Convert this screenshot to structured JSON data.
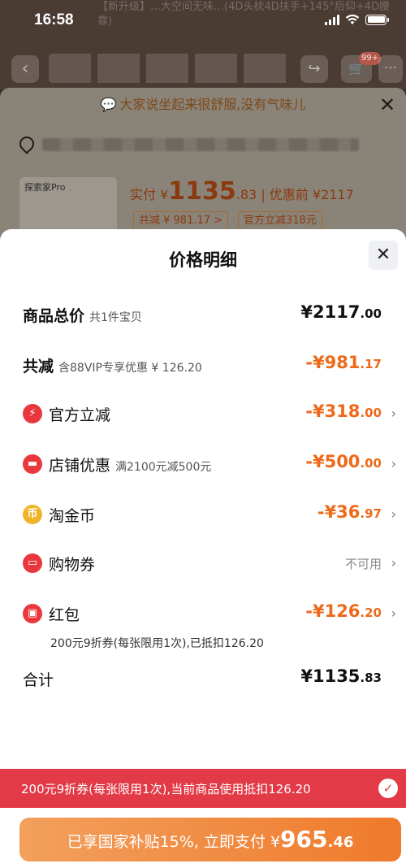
{
  "status": {
    "time": "16:58"
  },
  "background": {
    "title_text": "【新升级】…大空间无味…(4D头枕4D扶手+145°后仰+4D腰靠)",
    "cart_badge": "99+"
  },
  "secondary_sheet": {
    "tip": "大家说坐起来很舒服,没有气味儿",
    "product_thumb_label": "探索家Pro",
    "real_price_prefix": "实付 ¥",
    "real_price_int": "1135",
    "real_price_dec": ".83",
    "before_discount": "| 优惠前 ¥2117",
    "tag_reduce": "共减 ¥ 981.17 >",
    "tag_official": "官方立减318元"
  },
  "sheet": {
    "title": "价格明细",
    "rows": [
      {
        "label": "商品总价",
        "sub": "共1件宝贝",
        "amount_int": "¥2117",
        "amount_dec": ".00"
      },
      {
        "label": "共减",
        "sub": "含88VIP专享优惠 ¥ 126.20",
        "amount_int": "-¥981",
        "amount_dec": ".17"
      },
      {
        "label": "官方立减",
        "amount_int": "-¥318",
        "amount_dec": ".00"
      },
      {
        "label": "店铺优惠",
        "sub": "满2100元减500元",
        "amount_int": "-¥500",
        "amount_dec": ".00"
      },
      {
        "label": "淘金币",
        "amount_int": "-¥36",
        "amount_dec": ".97"
      },
      {
        "label": "购物券",
        "amount_text": "不可用"
      },
      {
        "label": "红包",
        "amount_int": "-¥126",
        "amount_dec": ".20"
      },
      {
        "label": "合计",
        "amount_int": "¥1135",
        "amount_dec": ".83"
      }
    ],
    "redpack_note": "200元9折券(每张限用1次),已抵扣126.20"
  },
  "coupon_bar": {
    "text": "200元9折券(每张限用1次),当前商品使用抵扣126.20"
  },
  "pay_button": {
    "prefix": "已享国家补贴15%, 立即支付 ¥",
    "amount_int": "965",
    "amount_dec": ".46"
  },
  "colors": {
    "accent_orange": "#ee6a1a",
    "coupon_red": "#e23a47",
    "icon_official": "#e8383d",
    "icon_store": "#e8383d",
    "icon_coin": "#f0b429",
    "icon_voucher": "#e8383d",
    "icon_redpack": "#e8383d"
  }
}
